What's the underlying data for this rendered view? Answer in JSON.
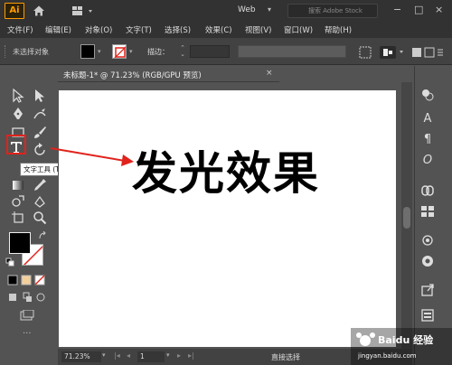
{
  "app": {
    "logo": "Ai",
    "workspace": "Web",
    "search_placeholder": "搜索 Adobe Stock",
    "window_controls": [
      "−",
      "□",
      "×"
    ]
  },
  "menu": [
    "文件(F)",
    "编辑(E)",
    "对象(O)",
    "文字(T)",
    "选择(S)",
    "效果(C)",
    "视图(V)",
    "窗口(W)",
    "帮助(H)"
  ],
  "control_bar": {
    "selection_label": "未选择对象",
    "stroke_label": "描边："
  },
  "document": {
    "tab_label": "未标题-1* @ 71.23% (RGB/GPU 预览)",
    "close": "×",
    "artboard_text": "发光效果"
  },
  "toolbar": {
    "tooltip": "文字工具 (T)",
    "highlight_color": "#e0231c"
  },
  "status": {
    "zoom": "71.23%",
    "page": "1",
    "current_tool": "直接选择"
  },
  "watermark": {
    "text": "Baidu 经验",
    "url": "jingyan.baidu.com"
  },
  "icons": [
    "home-icon",
    "search-icon",
    "selection-tool-icon",
    "direct-selection-icon",
    "pen-icon",
    "brush-icon",
    "type-tool-icon",
    "eyedropper-icon",
    "zoom-icon",
    "color-panel-icon",
    "properties-icon"
  ]
}
